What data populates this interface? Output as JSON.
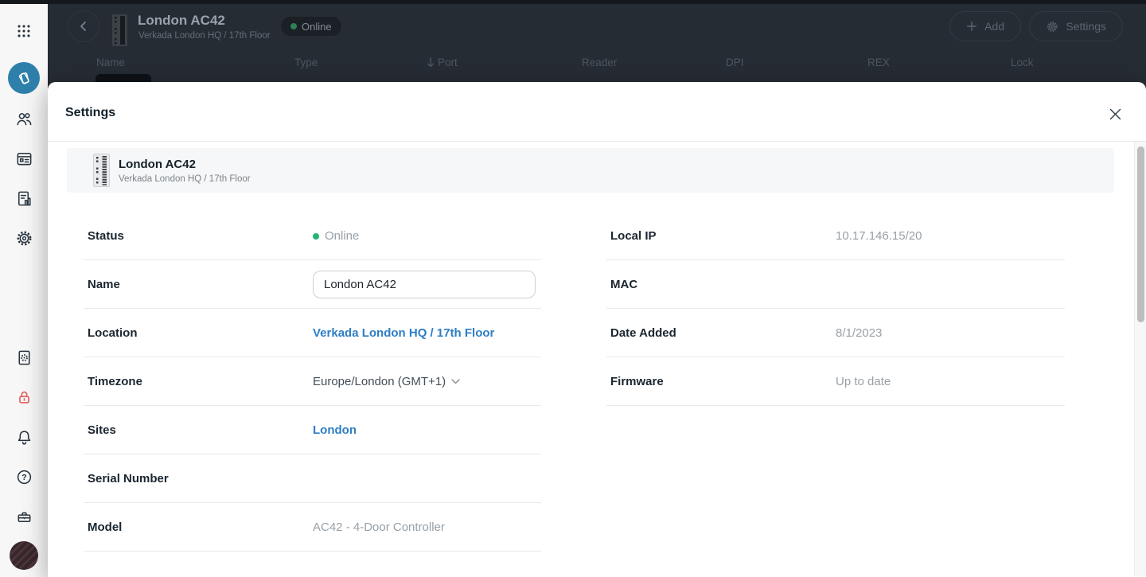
{
  "colors": {
    "accent_blue": "#2e7ec4",
    "status_online_green": "#21b573",
    "lockdown_red": "#e25f5e",
    "active_nav_blue": "#2e80ab"
  },
  "sidebar": {
    "items": [
      {
        "icon": "apps-grid-icon"
      },
      {
        "icon": "access-control-icon",
        "active": true
      },
      {
        "icon": "people-icon"
      },
      {
        "icon": "calendar-icon"
      },
      {
        "icon": "reports-icon"
      },
      {
        "icon": "settings-gear-icon"
      },
      {
        "icon": "device-diagnostics-icon"
      },
      {
        "icon": "lockdown-icon"
      },
      {
        "icon": "notifications-bell-icon"
      },
      {
        "icon": "help-icon"
      },
      {
        "icon": "toolbox-icon"
      },
      {
        "icon": "user-avatar"
      }
    ]
  },
  "background": {
    "device": {
      "title": "London AC42",
      "subtitle": "Verkada London HQ / 17th Floor"
    },
    "status_badge": "Online",
    "actions": {
      "add": "Add",
      "settings": "Settings"
    },
    "table_headers": [
      "Name",
      "Type",
      "Port",
      "Reader",
      "DPI",
      "REX",
      "Lock"
    ]
  },
  "modal": {
    "title": "Settings",
    "device_card": {
      "title": "London AC42",
      "subtitle": "Verkada London HQ / 17th Floor"
    },
    "fields_left": [
      {
        "label": "Status",
        "value": "Online"
      },
      {
        "label": "Name",
        "value": "London AC42"
      },
      {
        "label": "Location",
        "value": "Verkada London HQ / 17th Floor"
      },
      {
        "label": "Timezone",
        "value": "Europe/London (GMT+1)"
      },
      {
        "label": "Sites",
        "value": "London"
      },
      {
        "label": "Serial Number",
        "value": ""
      },
      {
        "label": "Model",
        "value": "AC42 - 4-Door Controller"
      }
    ],
    "fields_right": [
      {
        "label": "Local IP",
        "value": "10.17.146.15/20"
      },
      {
        "label": "MAC",
        "value": ""
      },
      {
        "label": "Date Added",
        "value": "8/1/2023"
      },
      {
        "label": "Firmware",
        "value": "Up to date"
      }
    ]
  }
}
